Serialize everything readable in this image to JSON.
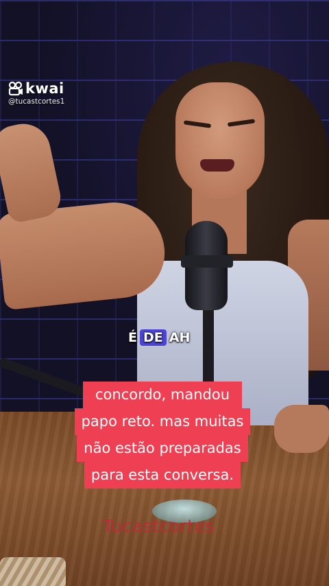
{
  "watermark": {
    "brand": "kwai",
    "handle": "@tucastcortes1"
  },
  "word_caption": {
    "words": [
      "É",
      "DE",
      "AH"
    ],
    "highlighted_index": 1,
    "highlight_color": "#4b45d6"
  },
  "comment_caption": {
    "lines": [
      "concordo, mandou",
      "papo reto. mas muitas",
      "não estão preparadas",
      "para esta conversa."
    ],
    "background_color": "#ef3f52"
  },
  "channel_watermark": "Tucastcortes"
}
